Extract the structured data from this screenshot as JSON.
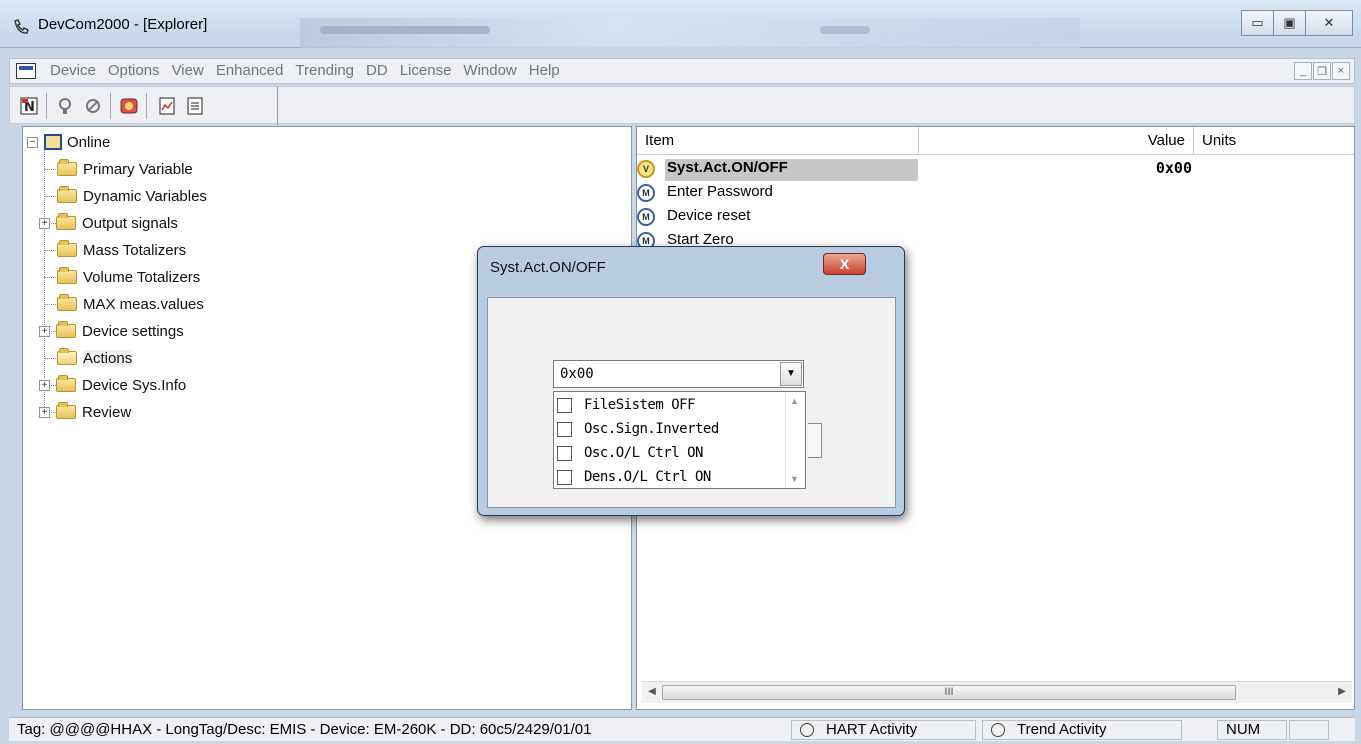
{
  "window": {
    "title": "DevCom2000 - [Explorer]"
  },
  "window_controls": {
    "minimize": "▭",
    "maximize": "▣",
    "close": "✕"
  },
  "menubar": {
    "items": [
      "Device",
      "Options",
      "View",
      "Enhanced",
      "Trending",
      "DD",
      "License",
      "Window",
      "Help"
    ],
    "mdi_controls": {
      "minimize": "_",
      "restore": "❐",
      "close": "×"
    }
  },
  "toolbar": {
    "icons": [
      "n-network-icon",
      "connect-icon",
      "disconnect-icon",
      "device-icon",
      "report-icon",
      "document-icon"
    ]
  },
  "tree": {
    "root": "Online",
    "items": [
      {
        "label": "Primary Variable",
        "expandable": false
      },
      {
        "label": "Dynamic Variables",
        "expandable": false
      },
      {
        "label": "Output signals",
        "expandable": true
      },
      {
        "label": "Mass Totalizers",
        "expandable": false
      },
      {
        "label": "Volume Totalizers",
        "expandable": false
      },
      {
        "label": "MAX meas.values",
        "expandable": false
      },
      {
        "label": "Device settings",
        "expandable": true
      },
      {
        "label": "Actions",
        "expandable": false
      },
      {
        "label": "Device Sys.Info",
        "expandable": true
      },
      {
        "label": "Review",
        "expandable": true
      }
    ]
  },
  "list": {
    "columns": [
      "Item",
      "Value",
      "Units"
    ],
    "rows": [
      {
        "name": "Syst.Act.ON/OFF",
        "value": "0x00",
        "units": "",
        "icon": "V"
      },
      {
        "name": "Enter Password",
        "value": "",
        "units": "",
        "icon": "M"
      },
      {
        "name": "Device reset",
        "value": "",
        "units": "",
        "icon": "M"
      },
      {
        "name": "Start Zero",
        "value": "",
        "units": "",
        "icon": "M"
      }
    ],
    "scroll_thumb": "III"
  },
  "dialog": {
    "title": "Syst.Act.ON/OFF",
    "close": "X",
    "combo_value": "0x00",
    "combo_arrow": "▼",
    "options": [
      {
        "label": "FileSistem OFF",
        "checked": false
      },
      {
        "label": "Osc.Sign.Inverted",
        "checked": false
      },
      {
        "label": "Osc.O/L Ctrl ON",
        "checked": false
      },
      {
        "label": "Dens.O/L Ctrl ON",
        "checked": false
      }
    ]
  },
  "statusbar": {
    "tag": "Tag: @@@@HHAX - LongTag/Desc: EMIS - Device: EM-260K - DD: 60c5/2429/01/01",
    "hart": "HART Activity",
    "trend": "Trend Activity",
    "num": "NUM"
  }
}
